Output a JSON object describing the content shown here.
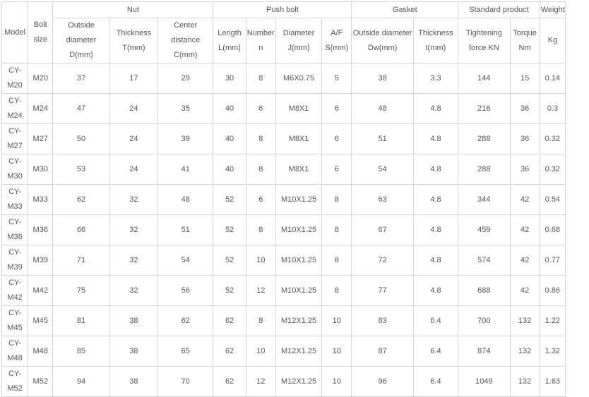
{
  "table": {
    "headers": {
      "model": "Model",
      "bolt_size": "Bolt\nsize",
      "nut": "Nut",
      "push_bolt": "Push bolt",
      "gasket": "Gasket",
      "standard_product": "Standard product",
      "weight": "Weight",
      "nut_outside_diameter": "Outside diameter D(mm)",
      "nut_thickness": "Thickness T(mm)",
      "nut_center_distance": "Center distance C(mm)",
      "pb_length": "Length L(mm)",
      "pb_number": "Number n",
      "pb_diameter": "Diameter J(mm)",
      "pb_af": "A/F S(mm)",
      "gasket_outside_diameter": "Outside diameter Dw(mm)",
      "gasket_thickness": "Thickness t(mm)",
      "tightening_force": "Tightening force KN",
      "torque": "Torque Nm",
      "weight_unit": "Kg"
    },
    "rows": [
      [
        "CY-\nM20",
        "M20",
        "37",
        "17",
        "29",
        "30",
        "8",
        "M6X0.75",
        "5",
        "38",
        "3.3",
        "144",
        "15",
        "0.14"
      ],
      [
        "CY-\nM24",
        "M24",
        "47",
        "24",
        "35",
        "40",
        "6",
        "M8X1",
        "6",
        "48",
        "4.8",
        "216",
        "36",
        "0.3"
      ],
      [
        "CY-\nM27",
        "M27",
        "50",
        "24",
        "39",
        "40",
        "8",
        "M8X1",
        "6",
        "51",
        "4.8",
        "288",
        "36",
        "0.32"
      ],
      [
        "CY-\nM30",
        "M30",
        "53",
        "24",
        "41",
        "40",
        "8",
        "M8X1",
        "6",
        "54",
        "4.8",
        "288",
        "36",
        "0.32"
      ],
      [
        "CY-\nM33",
        "M33",
        "62",
        "32",
        "48",
        "52",
        "6",
        "M10X1.25",
        "8",
        "63",
        "4.8",
        "344",
        "42",
        "0.54"
      ],
      [
        "CY-\nM36",
        "M36",
        "66",
        "32",
        "51",
        "52",
        "8",
        "M10X1.25",
        "8",
        "67",
        "4.8",
        "459",
        "42",
        "0.68"
      ],
      [
        "CY-\nM39",
        "M39",
        "71",
        "32",
        "54",
        "52",
        "10",
        "M10X1.25",
        "8",
        "72",
        "4.8",
        "574",
        "42",
        "0.77"
      ],
      [
        "CY-\nM42",
        "M42",
        "75",
        "32",
        "56",
        "52",
        "12",
        "M10X1.25",
        "8",
        "77",
        "4.8",
        "688",
        "42",
        "0.86"
      ],
      [
        "CY-\nM45",
        "M45",
        "81",
        "38",
        "62",
        "62",
        "8",
        "M12X1.25",
        "10",
        "83",
        "6.4",
        "700",
        "132",
        "1.22"
      ],
      [
        "CY-\nM48",
        "M48",
        "85",
        "38",
        "65",
        "62",
        "10",
        "M12X1.25",
        "10",
        "87",
        "6.4",
        "874",
        "132",
        "1.32"
      ],
      [
        "CY-\nM52",
        "M52",
        "94",
        "38",
        "70",
        "62",
        "12",
        "M12X1.25",
        "10",
        "96",
        "6.4",
        "1049",
        "132",
        "1.63"
      ]
    ]
  }
}
